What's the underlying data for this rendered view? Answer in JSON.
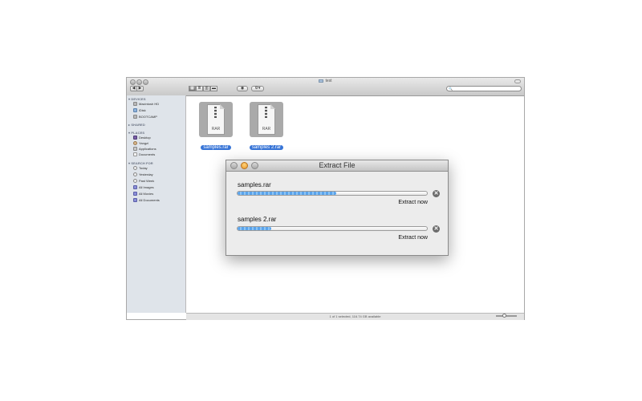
{
  "finder": {
    "title": "test",
    "nav": {
      "back": "◀",
      "forward": "▶"
    },
    "view_icons": [
      "▦",
      "≣",
      "▥",
      "▬"
    ],
    "eye": "◉",
    "gear": "⚙▾",
    "search_icon": "🔍",
    "sidebar": {
      "sections": [
        {
          "label": "DEVICES",
          "items": [
            "Macintosh HD",
            "iDisk",
            "BOOTCAMP"
          ]
        },
        {
          "label": "SHARED",
          "items": []
        },
        {
          "label": "PLACES",
          "items": [
            "Desktop",
            "Yangzi",
            "Applications",
            "Documents"
          ]
        },
        {
          "label": "SEARCH FOR",
          "items": [
            "Today",
            "Yesterday",
            "Past Week",
            "All Images",
            "All Movies",
            "All Documents"
          ]
        }
      ]
    },
    "files": [
      {
        "name": "samples.rar",
        "label": "RAR"
      },
      {
        "name": "samples 2.rar",
        "label": "RAR"
      }
    ],
    "status_text": "1 of 1 selected, 116.74 GB available"
  },
  "dialog": {
    "title": "Extract File",
    "cancel_glyph": "✕",
    "tasks": [
      {
        "name": "samples.rar",
        "progress": 0.52,
        "action": "Extract now"
      },
      {
        "name": "samples 2.rar",
        "progress": 0.18,
        "action": "Extract now"
      }
    ]
  },
  "colors": {
    "selection": "#3875d7",
    "progress": "#5aa4ec"
  }
}
